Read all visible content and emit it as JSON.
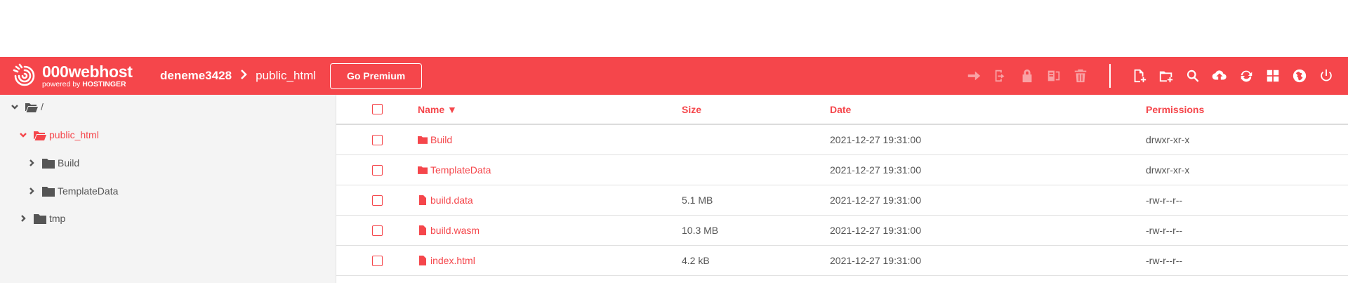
{
  "header": {
    "logo_name": "000webhost",
    "logo_sub_prefix": "powered by",
    "logo_sub_brand": "HOSTINGER",
    "site": "deneme3428",
    "folder": "public_html",
    "premium_label": "Go Premium",
    "accent": "#f5464b"
  },
  "toolbar": {
    "disabled": [
      "move-icon",
      "rename-icon",
      "permissions-icon",
      "extract-icon",
      "delete-icon"
    ],
    "enabled": [
      "new-file-icon",
      "new-folder-icon",
      "search-icon",
      "upload-icon",
      "refresh-icon",
      "view-grid-icon",
      "globe-icon",
      "power-icon"
    ]
  },
  "tree": {
    "root": "/",
    "public_html": "public_html",
    "build": "Build",
    "template": "TemplateData",
    "tmp": "tmp"
  },
  "table": {
    "columns": {
      "name": "Name ▼",
      "size": "Size",
      "date": "Date",
      "permissions": "Permissions"
    },
    "rows": [
      {
        "type": "folder",
        "name": "Build",
        "size": "",
        "date": "2021-12-27 19:31:00",
        "perm": "drwxr-xr-x"
      },
      {
        "type": "folder",
        "name": "TemplateData",
        "size": "",
        "date": "2021-12-27 19:31:00",
        "perm": "drwxr-xr-x"
      },
      {
        "type": "file",
        "name": "build.data",
        "size": "5.1 MB",
        "date": "2021-12-27 19:31:00",
        "perm": "-rw-r--r--"
      },
      {
        "type": "file",
        "name": "build.wasm",
        "size": "10.3 MB",
        "date": "2021-12-27 19:31:00",
        "perm": "-rw-r--r--"
      },
      {
        "type": "file",
        "name": "index.html",
        "size": "4.2 kB",
        "date": "2021-12-27 19:31:00",
        "perm": "-rw-r--r--"
      }
    ]
  }
}
